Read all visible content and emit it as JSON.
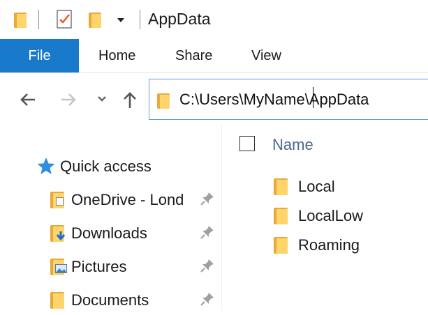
{
  "window": {
    "title": "AppData"
  },
  "ribbon": {
    "tabs": [
      "File",
      "Home",
      "Share",
      "View"
    ]
  },
  "address_bar": {
    "path": "C:\\Users\\MyName\\AppData"
  },
  "sidebar": {
    "quick_access_label": "Quick access",
    "items": [
      {
        "label": "OneDrive - Lond",
        "icon": "onedrive-folder-icon",
        "pinned": true
      },
      {
        "label": "Downloads",
        "icon": "downloads-folder-icon",
        "pinned": true
      },
      {
        "label": "Pictures",
        "icon": "pictures-folder-icon",
        "pinned": true
      },
      {
        "label": "Documents",
        "icon": "documents-folder-icon",
        "pinned": true
      }
    ]
  },
  "file_list": {
    "column_header": "Name",
    "items": [
      {
        "name": "Local",
        "icon": "folder-icon"
      },
      {
        "name": "LocalLow",
        "icon": "folder-icon"
      },
      {
        "name": "Roaming",
        "icon": "folder-icon"
      }
    ]
  },
  "colors": {
    "accent": "#1979ca",
    "folder_front": "#ffd46b",
    "folder_back": "#e8a93a",
    "star": "#2d8fe0"
  }
}
